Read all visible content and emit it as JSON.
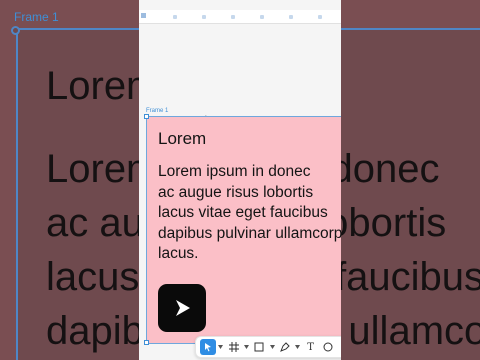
{
  "background": {
    "frame_label": "Frame 1",
    "title": "Lorem",
    "body_lines": [
      "Lorem ipsum in donec",
      "ac augue risus lobortis",
      "lacus vitae eget faucibus",
      "dapibus pulvinar ullamcorper"
    ]
  },
  "editor": {
    "frame_label": "Frame 1",
    "card": {
      "title": "Lorem",
      "body_lines": [
        "Lorem ipsum in donec",
        "ac augue risus lobortis",
        "lacus vitae eget faucibus",
        "dapibus pulvinar ullamcorper",
        "lacus."
      ]
    },
    "toolbar": {
      "tools": [
        "pointer-tool-icon",
        "frame-tool-icon",
        "rectangle-tool-icon",
        "pen-tool-icon",
        "text-tool-icon",
        "ellipse-tool-icon",
        "more-tool-icon"
      ],
      "text_tool_glyph": "T"
    }
  },
  "colors": {
    "frame_fill": "#fbbfc7",
    "selection_blue": "#3f8fd6",
    "button_black": "#0a0a0a"
  }
}
